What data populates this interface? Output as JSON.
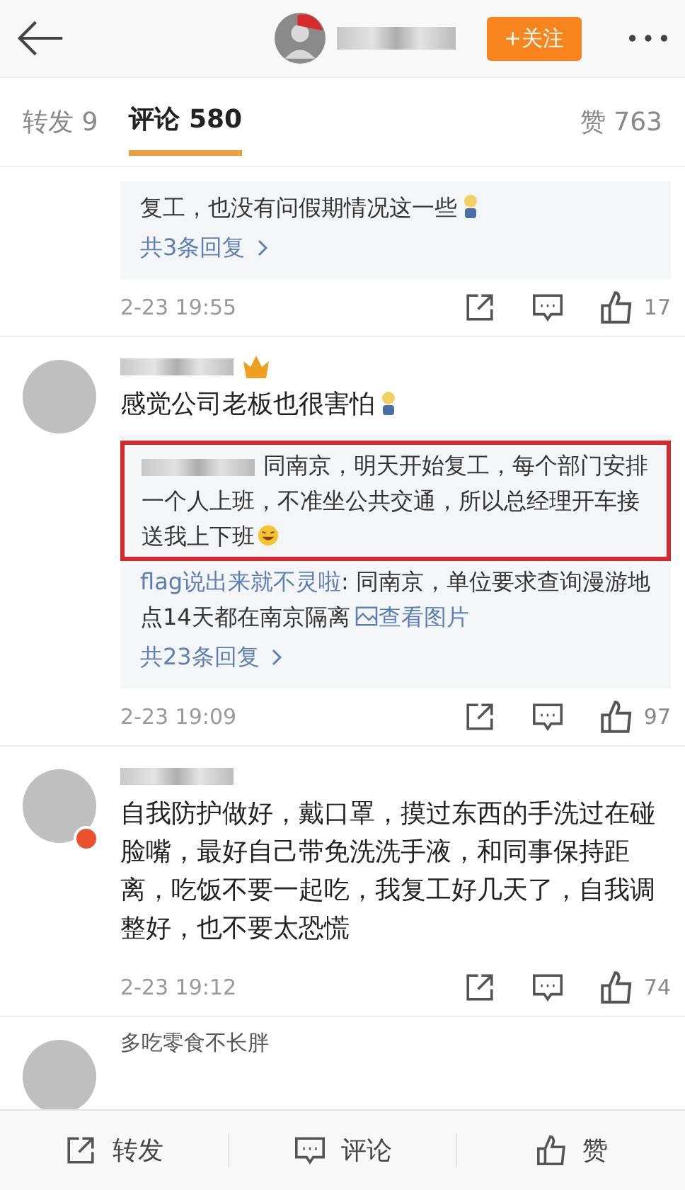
{
  "header": {
    "follow_button": "+关注"
  },
  "tabs": [
    {
      "label": "转发 9",
      "selected": false
    },
    {
      "label": "评论 580",
      "selected": true
    },
    {
      "label": "赞 763",
      "selected": false
    }
  ],
  "comments": [
    {
      "kind": "continued",
      "replies": [
        {
          "text": "复工，也没有问假期情况这一些",
          "emoji": {
            "kind": "figure"
          },
          "highlighted": false
        }
      ],
      "more": "共3条回复",
      "time": "2-23 19:55",
      "likes": "17"
    },
    {
      "kind": "full",
      "avatar_badge": false,
      "crown": true,
      "text": "感觉公司老板也很害怕",
      "emoji": {
        "kind": "figure"
      },
      "replies": [
        {
          "author_blurred": true,
          "text": "同南京，明天开始复工，每个部门安排一个人上班，不准坐公共交通，所以总经理开车接送我上下班",
          "emoji": {
            "kind": "laughing"
          },
          "highlighted": true
        },
        {
          "author": "flag说出来就不灵啦",
          "text": ": 同南京，单位要求查询漫游地点14天都在南京隔离",
          "link": "查看图片",
          "highlighted": false
        }
      ],
      "more": "共23条回复",
      "time": "2-23 19:09",
      "likes": "97"
    },
    {
      "kind": "full",
      "avatar_badge": true,
      "crown": false,
      "text": "自我防护做好，戴口罩，摸过东西的手洗过在碰脸嘴，最好自己带免洗洗手液，和同事保持距离，吃饭不要一起吃，我复工好几天了，自我调整好，也不要太恐慌",
      "time": "2-23 19:12",
      "likes": "74"
    },
    {
      "kind": "cut",
      "name": "多吃零食不长胖"
    }
  ],
  "bottom_bar": [
    {
      "kind": "repost",
      "label": "转发"
    },
    {
      "kind": "comment",
      "label": "评论"
    },
    {
      "kind": "like",
      "label": "赞"
    }
  ]
}
